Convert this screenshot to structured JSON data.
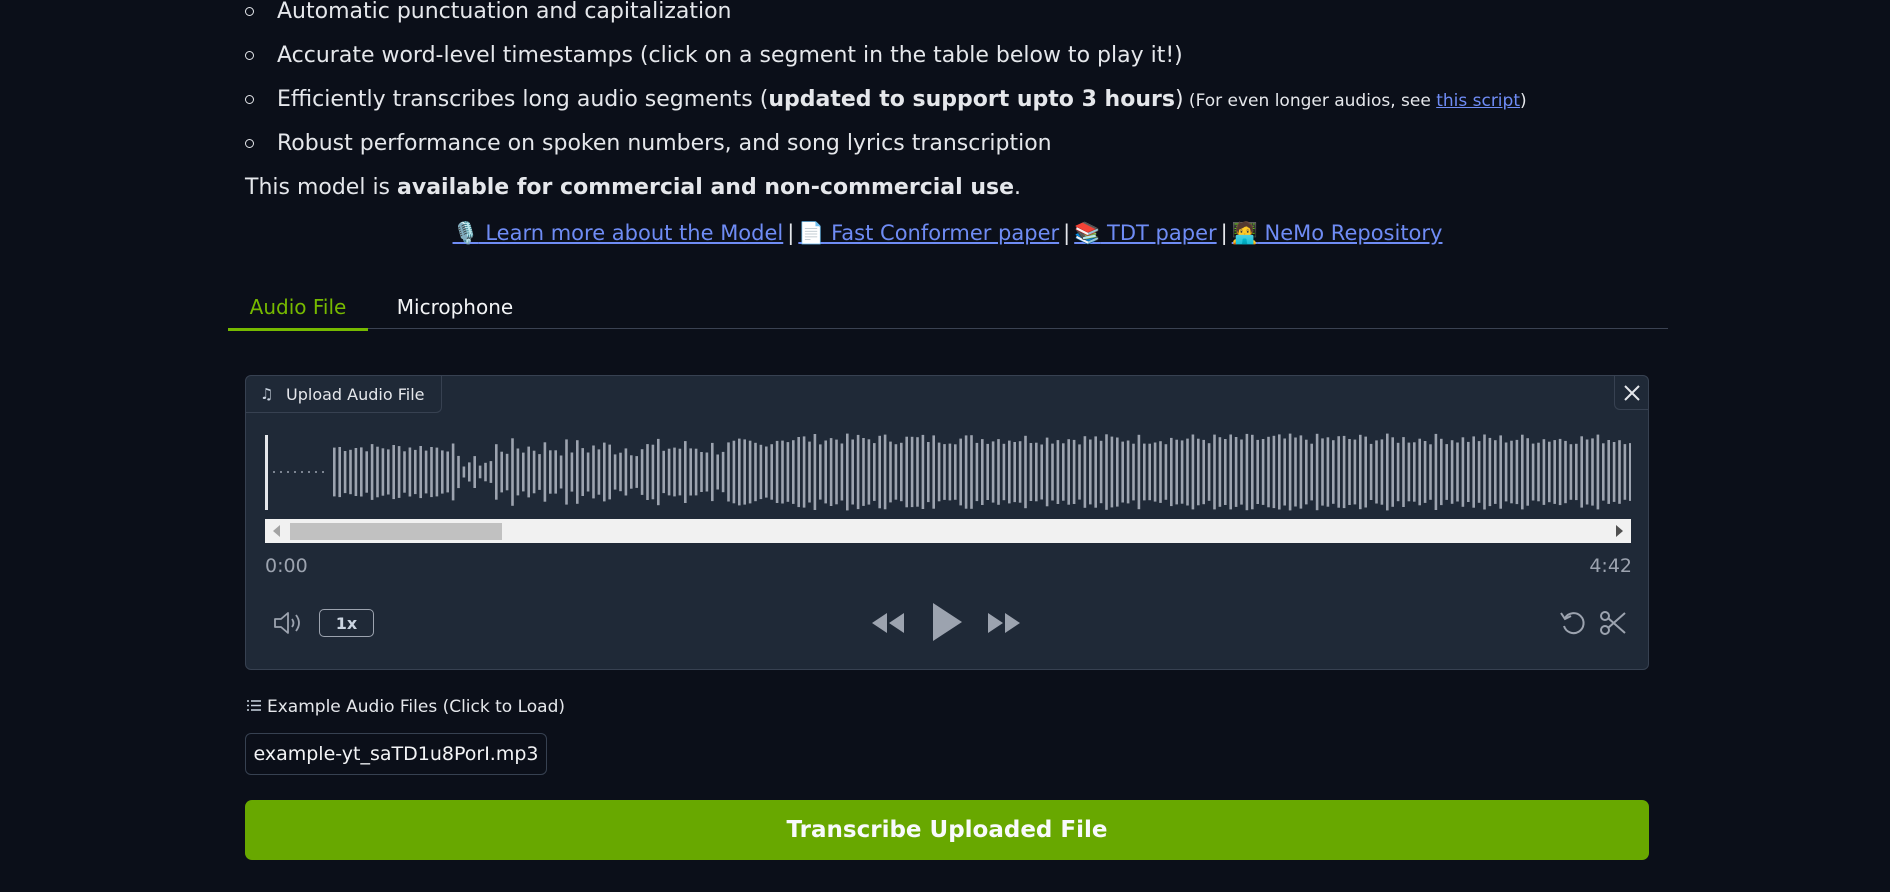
{
  "features": [
    {
      "text": "Automatic punctuation and capitalization"
    },
    {
      "text": "Accurate word-level timestamps (click on a segment in the table below to play it!)"
    },
    {
      "pre": "Efficiently transcribes long audio segments (",
      "bold": "updated to support upto 3 hours",
      "post": ")",
      "note_pre": " (For even longer audios, see ",
      "note_link": "this script",
      "note_post": ")"
    },
    {
      "text": "Robust performance on spoken numbers, and song lyrics transcription"
    }
  ],
  "commercial": {
    "pre": "This model is ",
    "bold": "available for commercial and non-commercial use",
    "post": "."
  },
  "links": [
    {
      "emoji": "🎙️",
      "label": " Learn more about the Model"
    },
    {
      "emoji": "📄",
      "label": " Fast Conformer paper"
    },
    {
      "emoji": "📚",
      "label": " TDT paper"
    },
    {
      "emoji": "🧑‍💻",
      "label": " NeMo Repository"
    }
  ],
  "link_separator": "|",
  "tabs": [
    {
      "label": "Audio File",
      "active": true
    },
    {
      "label": "Microphone",
      "active": false
    }
  ],
  "player": {
    "upload_label": "Upload Audio File",
    "time_start": "0:00",
    "time_end": "4:42",
    "speed": "1x",
    "scroll_position": 0.16
  },
  "examples": {
    "label": "Example Audio Files (Click to Load)",
    "items": [
      "example-yt_saTD1u8PorI.mp3"
    ]
  },
  "transcribe_button": "Transcribe Uploaded File",
  "colors": {
    "accent": "#76b900",
    "button": "#68a800",
    "link": "#6f8cf5",
    "background": "#0b0f19"
  }
}
